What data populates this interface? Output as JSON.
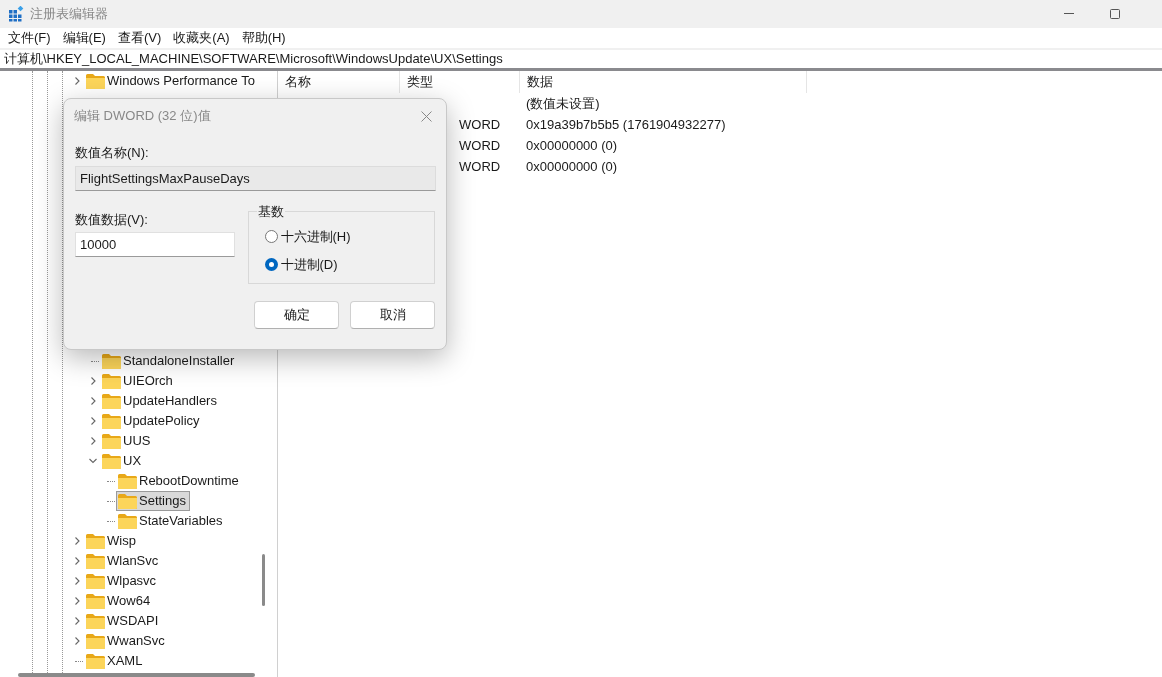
{
  "window": {
    "title": "注册表编辑器"
  },
  "menu": [
    "文件(F)",
    "编辑(E)",
    "查看(V)",
    "收藏夹(A)",
    "帮助(H)"
  ],
  "address": "计算机\\HKEY_LOCAL_MACHINE\\SOFTWARE\\Microsoft\\WindowsUpdate\\UX\\Settings",
  "tree": [
    {
      "kind": "branch",
      "label": "Windows Performance To",
      "expanded": false,
      "selected": false
    },
    {
      "kind": "hidden",
      "children": [
        {
          "kind": "leaf",
          "label": "StandaloneInstaller",
          "selected": false
        },
        {
          "kind": "branch",
          "label": "UIEOrch",
          "expanded": false,
          "selected": false
        },
        {
          "kind": "branch",
          "label": "UpdateHandlers",
          "expanded": false,
          "selected": false
        },
        {
          "kind": "branch",
          "label": "UpdatePolicy",
          "expanded": false,
          "selected": false
        },
        {
          "kind": "branch",
          "label": "UUS",
          "expanded": false,
          "selected": false
        },
        {
          "kind": "branch",
          "label": "UX",
          "expanded": true,
          "selected": false,
          "children": [
            {
              "kind": "leaf",
              "label": "RebootDowntime",
              "selected": false
            },
            {
              "kind": "leaf",
              "label": "Settings",
              "selected": true
            },
            {
              "kind": "leaf",
              "label": "StateVariables",
              "selected": false
            }
          ]
        }
      ]
    },
    {
      "kind": "branch",
      "label": "Wisp",
      "expanded": false,
      "selected": false
    },
    {
      "kind": "branch",
      "label": "WlanSvc",
      "expanded": false,
      "selected": false
    },
    {
      "kind": "branch",
      "label": "Wlpasvc",
      "expanded": false,
      "selected": false
    },
    {
      "kind": "branch",
      "label": "Wow64",
      "expanded": false,
      "selected": false
    },
    {
      "kind": "branch",
      "label": "WSDAPI",
      "expanded": false,
      "selected": false
    },
    {
      "kind": "branch",
      "label": "WwanSvc",
      "expanded": false,
      "selected": false
    },
    {
      "kind": "leaf",
      "label": "XAML",
      "selected": false
    }
  ],
  "table": {
    "columns": [
      "名称",
      "类型",
      "数据"
    ],
    "rows": [
      {
        "data": "(数值未设置)"
      },
      {
        "type": "WORD",
        "data": "0x19a39b7b5b5 (1761904932277)"
      },
      {
        "type": "WORD",
        "data": "0x00000000 (0)"
      },
      {
        "type": "WORD",
        "data": "0x00000000 (0)"
      }
    ]
  },
  "dialog": {
    "title": "编辑 DWORD (32 位)值",
    "name_label": "数值名称(N):",
    "name_value": "FlightSettingsMaxPauseDays",
    "data_label": "数值数据(V):",
    "data_value": "10000",
    "base_label": "基数",
    "bases": [
      {
        "label": "十六进制(H)",
        "selected": false
      },
      {
        "label": "十进制(D)",
        "selected": true
      }
    ],
    "buttons": [
      "确定",
      "取消"
    ]
  }
}
